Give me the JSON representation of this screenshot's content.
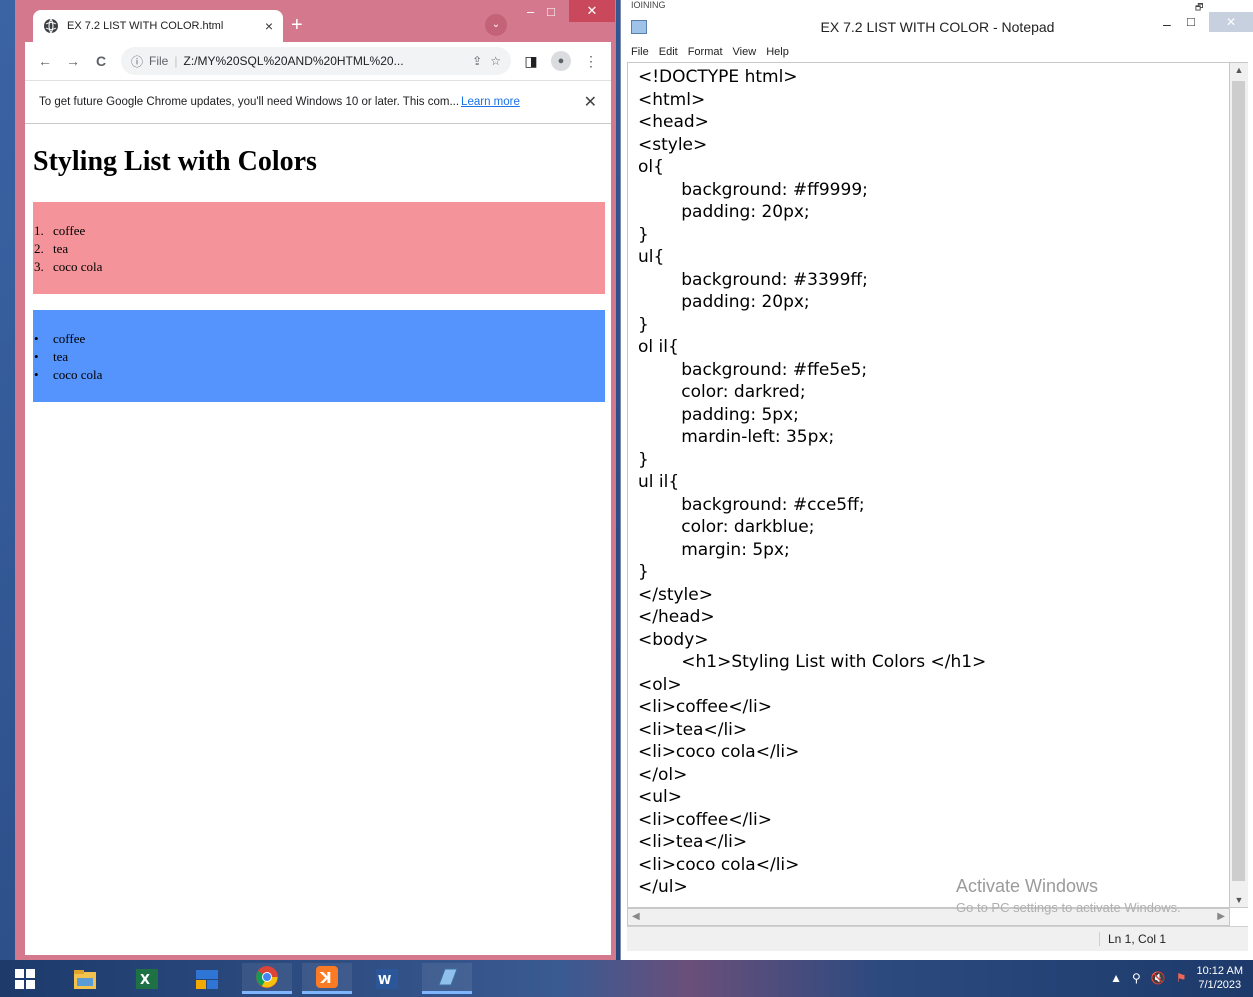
{
  "chrome": {
    "tab_title": "EX 7.2  LIST WITH COLOR.html",
    "tab_close": "×",
    "new_tab": "+",
    "tab_search": "⌄",
    "minimize": "–",
    "maximize": "□",
    "close": "✕",
    "nav_back": "←",
    "nav_forward": "→",
    "nav_reload": "C",
    "info_icon": "ⓘ",
    "scheme": "File",
    "separator": "|",
    "url": "Z:/MY%20SQL%20AND%20HTML%20...",
    "share_icon": "⇪",
    "star_icon": "☆",
    "sidepanel_icon": "◨",
    "menu_icon": "⋮",
    "infobar": {
      "message": "To get future Google Chrome updates, you'll need Windows 10 or later. This com...",
      "link": "Learn more",
      "close": "✕"
    },
    "page": {
      "heading": "Styling List with Colors",
      "ordered": [
        {
          "marker": "1.",
          "text": "coffee"
        },
        {
          "marker": "2.",
          "text": "tea"
        },
        {
          "marker": "3.",
          "text": "coco cola"
        }
      ],
      "unordered": [
        {
          "marker": "•",
          "text": "coffee"
        },
        {
          "marker": "•",
          "text": "tea"
        },
        {
          "marker": "•",
          "text": "coco cola"
        }
      ]
    }
  },
  "notepad": {
    "top_text": "IOINING",
    "restore_glyph": "🗗",
    "title": "EX 7.2  LIST WITH COLOR - Notepad",
    "minimize": "–",
    "maximize": "□",
    "close": "✕",
    "menu": [
      "File",
      "Edit",
      "Format",
      "View",
      "Help"
    ],
    "code": "<!DOCTYPE html>\n<html>\n<head>\n<style>\nol{\n\tbackground: #ff9999;\n\tpadding: 20px;\n}\nul{\n\tbackground: #3399ff;\n\tpadding: 20px;\n}\nol il{\n\tbackground: #ffe5e5;\n\tcolor: darkred;\n\tpadding: 5px;\n\tmardin-left: 35px;\n}\nul il{\n\tbackground: #cce5ff;\n\tcolor: darkblue;\n\tmargin: 5px;\n}\n</style>\n</head>\n<body>\n\t<h1>Styling List with Colors </h1>\n<ol>\n<li>coffee</li>\n<li>tea</li>\n<li>coco cola</li>\n</ol>\n<ul>\n<li>coffee</li>\n<li>tea</li>\n<li>coco cola</li>\n</ul>",
    "status_position": "Ln 1, Col 1",
    "watermark_title": "Activate Windows",
    "watermark_sub": "Go to PC settings to activate Windows."
  },
  "taskbar": {
    "clock_time": "10:12 AM",
    "clock_date": "7/1/2023",
    "tray_arrow": "▲"
  },
  "colors": {
    "ol_background": "#f4949a",
    "ul_background": "#5494fc",
    "chrome_frame": "#d4798d"
  }
}
